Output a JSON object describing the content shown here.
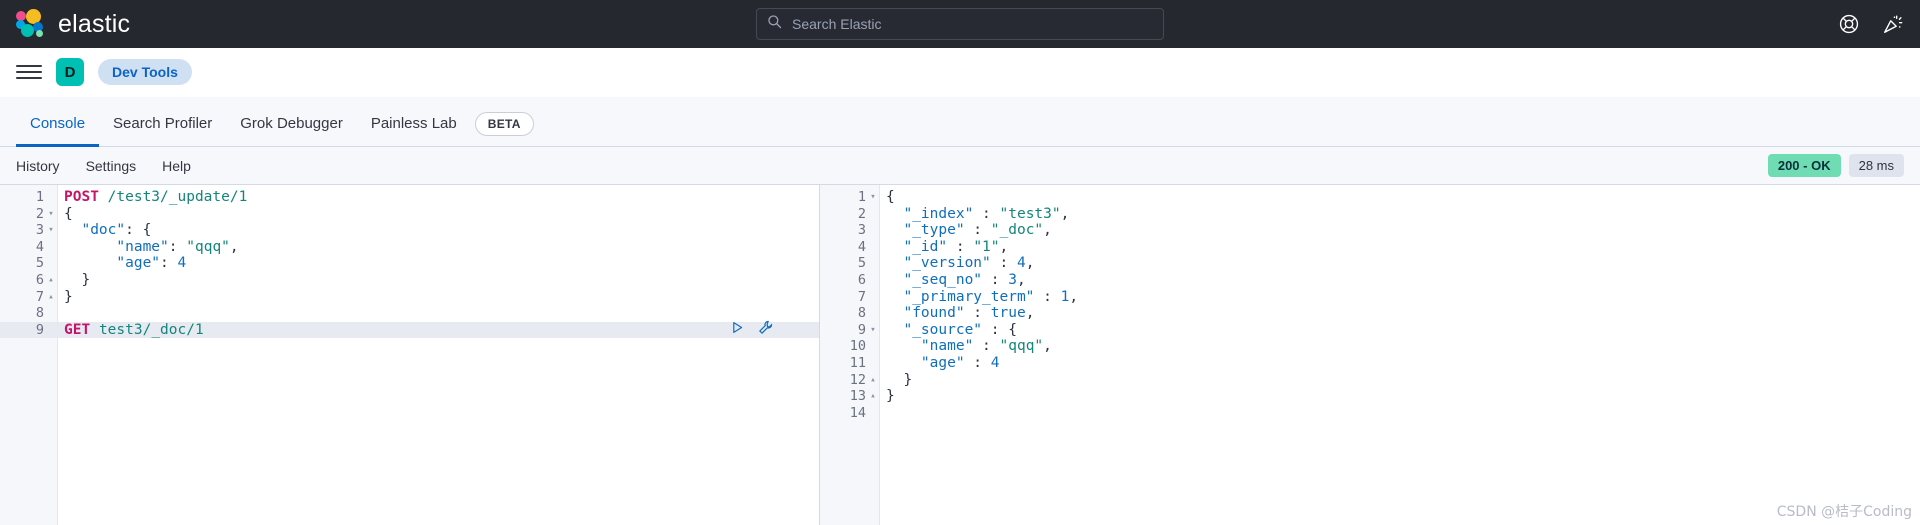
{
  "header": {
    "brand": "elastic",
    "logo_colors": [
      "#ef4e8e",
      "#f5bd22",
      "#00a9e5",
      "#00bfb3",
      "#0077cc",
      "#7de0b0"
    ],
    "search": {
      "placeholder": "Search Elastic",
      "value": "",
      "icon": "search-icon"
    },
    "icons": [
      {
        "name": "help-lifebuoy-icon",
        "glyph": "help"
      },
      {
        "name": "news-party-popper-icon",
        "glyph": "news"
      }
    ]
  },
  "breadcrumb": {
    "menu_icon": "hamburger-menu-icon",
    "space_initial": "D",
    "space_color": "#00bfb3",
    "crumb": "Dev Tools",
    "crumb_bg": "#cfe0f3",
    "crumb_fg": "#0b64c4"
  },
  "tabs": [
    {
      "label": "Console",
      "active": true
    },
    {
      "label": "Search Profiler",
      "active": false
    },
    {
      "label": "Grok Debugger",
      "active": false
    },
    {
      "label": "Painless Lab",
      "active": false
    }
  ],
  "beta_badge": "BETA",
  "console_toolbar": {
    "links": [
      "History",
      "Settings",
      "Help"
    ],
    "status": "200 - OK",
    "status_color": "#6fdcb4",
    "duration": "28 ms",
    "duration_color": "#dfe3ed"
  },
  "request_editor": {
    "active_line": 9,
    "lines": [
      {
        "n": 1,
        "fold": "",
        "tokens": [
          {
            "t": "POST",
            "c": "m"
          },
          {
            "t": " ",
            "c": "p"
          },
          {
            "t": "/test3/_update/1",
            "c": "u"
          }
        ]
      },
      {
        "n": 2,
        "fold": "▾",
        "tokens": [
          {
            "t": "{",
            "c": "p"
          }
        ]
      },
      {
        "n": 3,
        "fold": "▾",
        "tokens": [
          {
            "t": "  ",
            "c": "p"
          },
          {
            "t": "\"doc\"",
            "c": "k"
          },
          {
            "t": ": {",
            "c": "p"
          }
        ]
      },
      {
        "n": 4,
        "fold": "",
        "tokens": [
          {
            "t": "      ",
            "c": "p"
          },
          {
            "t": "\"name\"",
            "c": "k"
          },
          {
            "t": ": ",
            "c": "p"
          },
          {
            "t": "\"qqq\"",
            "c": "s"
          },
          {
            "t": ",",
            "c": "p"
          }
        ]
      },
      {
        "n": 5,
        "fold": "",
        "tokens": [
          {
            "t": "      ",
            "c": "p"
          },
          {
            "t": "\"age\"",
            "c": "k"
          },
          {
            "t": ": ",
            "c": "p"
          },
          {
            "t": "4",
            "c": "n"
          }
        ]
      },
      {
        "n": 6,
        "fold": "▴",
        "tokens": [
          {
            "t": "  }",
            "c": "p"
          }
        ]
      },
      {
        "n": 7,
        "fold": "▴",
        "tokens": [
          {
            "t": "}",
            "c": "p"
          }
        ]
      },
      {
        "n": 8,
        "fold": "",
        "tokens": []
      },
      {
        "n": 9,
        "fold": "",
        "tokens": [
          {
            "t": "GET",
            "c": "m"
          },
          {
            "t": " ",
            "c": "p"
          },
          {
            "t": "test3/_doc/1",
            "c": "u"
          }
        ]
      }
    ],
    "actions": [
      {
        "name": "play-send-request-icon"
      },
      {
        "name": "wrench-settings-icon"
      }
    ]
  },
  "response_viewer": {
    "lines": [
      {
        "n": 1,
        "fold": "▾",
        "tokens": [
          {
            "t": "{",
            "c": "p"
          }
        ]
      },
      {
        "n": 2,
        "fold": "",
        "tokens": [
          {
            "t": "  ",
            "c": "p"
          },
          {
            "t": "\"_index\"",
            "c": "k"
          },
          {
            "t": " : ",
            "c": "p"
          },
          {
            "t": "\"test3\"",
            "c": "s"
          },
          {
            "t": ",",
            "c": "p"
          }
        ]
      },
      {
        "n": 3,
        "fold": "",
        "tokens": [
          {
            "t": "  ",
            "c": "p"
          },
          {
            "t": "\"_type\"",
            "c": "k"
          },
          {
            "t": " : ",
            "c": "p"
          },
          {
            "t": "\"_doc\"",
            "c": "s"
          },
          {
            "t": ",",
            "c": "p"
          }
        ]
      },
      {
        "n": 4,
        "fold": "",
        "tokens": [
          {
            "t": "  ",
            "c": "p"
          },
          {
            "t": "\"_id\"",
            "c": "k"
          },
          {
            "t": " : ",
            "c": "p"
          },
          {
            "t": "\"1\"",
            "c": "s"
          },
          {
            "t": ",",
            "c": "p"
          }
        ]
      },
      {
        "n": 5,
        "fold": "",
        "tokens": [
          {
            "t": "  ",
            "c": "p"
          },
          {
            "t": "\"_version\"",
            "c": "k"
          },
          {
            "t": " : ",
            "c": "p"
          },
          {
            "t": "4",
            "c": "n"
          },
          {
            "t": ",",
            "c": "p"
          }
        ]
      },
      {
        "n": 6,
        "fold": "",
        "tokens": [
          {
            "t": "  ",
            "c": "p"
          },
          {
            "t": "\"_seq_no\"",
            "c": "k"
          },
          {
            "t": " : ",
            "c": "p"
          },
          {
            "t": "3",
            "c": "n"
          },
          {
            "t": ",",
            "c": "p"
          }
        ]
      },
      {
        "n": 7,
        "fold": "",
        "tokens": [
          {
            "t": "  ",
            "c": "p"
          },
          {
            "t": "\"_primary_term\"",
            "c": "k"
          },
          {
            "t": " : ",
            "c": "p"
          },
          {
            "t": "1",
            "c": "n"
          },
          {
            "t": ",",
            "c": "p"
          }
        ]
      },
      {
        "n": 8,
        "fold": "",
        "tokens": [
          {
            "t": "  ",
            "c": "p"
          },
          {
            "t": "\"found\"",
            "c": "k"
          },
          {
            "t": " : ",
            "c": "p"
          },
          {
            "t": "true",
            "c": "b"
          },
          {
            "t": ",",
            "c": "p"
          }
        ]
      },
      {
        "n": 9,
        "fold": "▾",
        "tokens": [
          {
            "t": "  ",
            "c": "p"
          },
          {
            "t": "\"_source\"",
            "c": "k"
          },
          {
            "t": " : {",
            "c": "p"
          }
        ]
      },
      {
        "n": 10,
        "fold": "",
        "tokens": [
          {
            "t": "    ",
            "c": "p"
          },
          {
            "t": "\"name\"",
            "c": "k"
          },
          {
            "t": " : ",
            "c": "p"
          },
          {
            "t": "\"qqq\"",
            "c": "s"
          },
          {
            "t": ",",
            "c": "p"
          }
        ]
      },
      {
        "n": 11,
        "fold": "",
        "tokens": [
          {
            "t": "    ",
            "c": "p"
          },
          {
            "t": "\"age\"",
            "c": "k"
          },
          {
            "t": " : ",
            "c": "p"
          },
          {
            "t": "4",
            "c": "n"
          }
        ]
      },
      {
        "n": 12,
        "fold": "▴",
        "tokens": [
          {
            "t": "  }",
            "c": "p"
          }
        ]
      },
      {
        "n": 13,
        "fold": "▴",
        "tokens": [
          {
            "t": "}",
            "c": "p"
          }
        ]
      },
      {
        "n": 14,
        "fold": "",
        "tokens": []
      }
    ]
  },
  "watermark": "CSDN @桔子Coding"
}
